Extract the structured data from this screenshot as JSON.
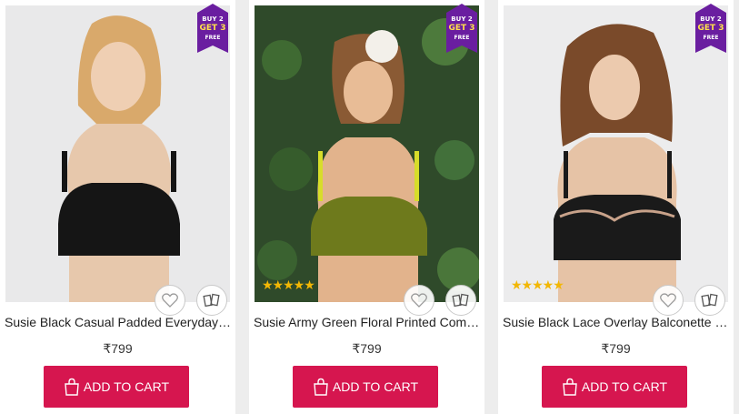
{
  "colors": {
    "accent": "#d6164f",
    "offer_badge": "#6a1ea0",
    "stars": "#f2b705",
    "page_bg": "#ededed"
  },
  "products": [
    {
      "name": "Susie Black Casual Padded Everyday Bra",
      "price": "₹799",
      "add_to_cart_label": "ADD TO CART",
      "offer": {
        "line1": "BUY 2",
        "line2": "GET 3",
        "line3": "FREE"
      },
      "rating": 0,
      "wishlist_icon": "heart-icon",
      "compare_icon": "compare-icon"
    },
    {
      "name": "Susie Army Green Floral Printed Comfort Bra",
      "price": "₹799",
      "add_to_cart_label": "ADD TO CART",
      "offer": {
        "line1": "BUY 2",
        "line2": "GET 3",
        "line3": "FREE"
      },
      "rating": 5,
      "rating_stars": "★★★★★",
      "wishlist_icon": "heart-icon",
      "compare_icon": "compare-icon"
    },
    {
      "name": "Susie Black Lace Overlay Balconette Bra",
      "price": "₹799",
      "add_to_cart_label": "ADD TO CART",
      "offer": {
        "line1": "BUY 2",
        "line2": "GET 3",
        "line3": "FREE"
      },
      "rating": 5,
      "rating_stars": "★★★★★",
      "wishlist_icon": "heart-icon",
      "compare_icon": "compare-icon"
    }
  ]
}
